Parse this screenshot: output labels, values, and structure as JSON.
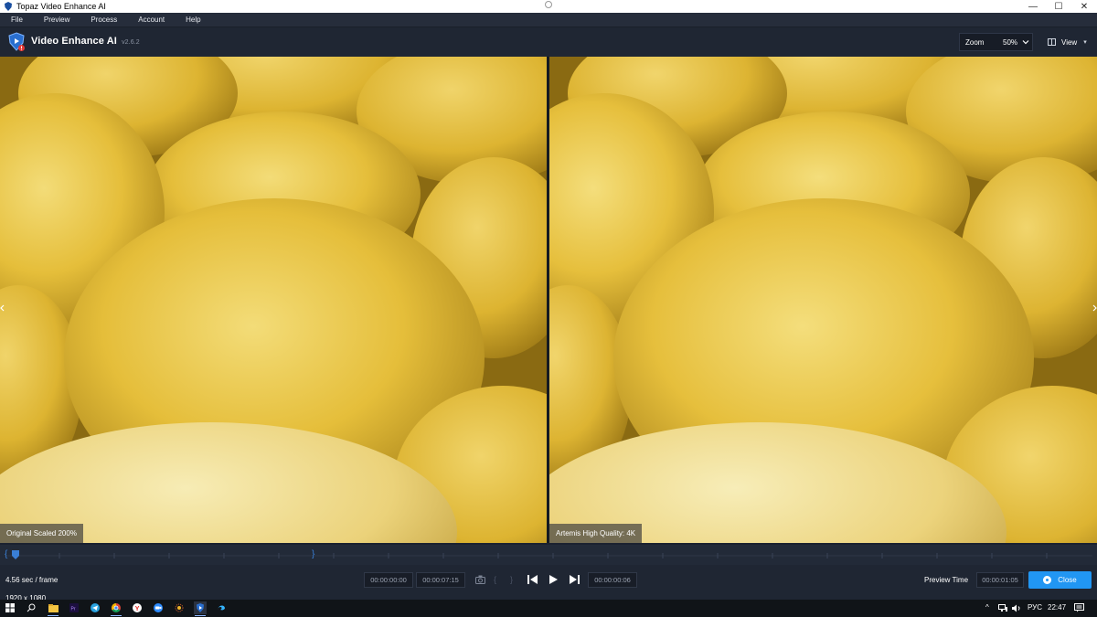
{
  "window": {
    "title": "Topaz Video Enhance AI",
    "controls": [
      "—",
      "☐",
      "✕"
    ]
  },
  "menu": {
    "items": [
      "File",
      "Preview",
      "Process",
      "Account",
      "Help"
    ]
  },
  "header": {
    "app_name": "Video Enhance AI",
    "version": "v2.6.2",
    "zoom_label": "Zoom",
    "zoom_value": "50%",
    "view_label": "View"
  },
  "viewports": {
    "left_label": "Original Scaled 200%",
    "right_label": "Artemis High Quality: 4K"
  },
  "controls": {
    "speed": "4.56 sec / frame",
    "resolution": "1920 x 1080",
    "time_start": "00:00:00:00",
    "time_end": "00:00:07:15",
    "time_current": "00:00:00:06",
    "preview_time_label": "Preview Time",
    "preview_time_value": "00:00:01:05",
    "close_label": "Close"
  },
  "taskbar": {
    "lang": "РУС",
    "clock": "22:47"
  },
  "colors": {
    "accent": "#2196f3",
    "bg": "#1f2633",
    "timeline_bracket": "#3a7fd6"
  }
}
